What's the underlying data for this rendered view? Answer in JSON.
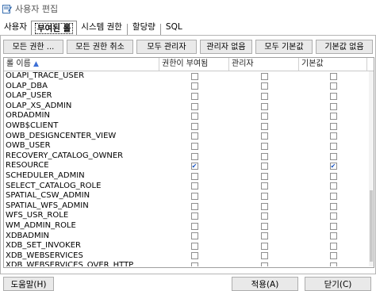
{
  "window": {
    "title": "사용자 편집",
    "icon": "edit-user-icon"
  },
  "tabs": [
    {
      "label": "사용자"
    },
    {
      "label": "부여된 롤"
    },
    {
      "label": "시스템 권한"
    },
    {
      "label": "할당량"
    },
    {
      "label": "SQL"
    }
  ],
  "toolbar": {
    "grant_all": "모든 권한 ...",
    "revoke_all": "모든 권한 취소",
    "all_admin": "모두 관리자",
    "no_admin": "관리자 없음",
    "all_default": "모두 기본값",
    "no_default": "기본값 없음"
  },
  "grid": {
    "headers": {
      "name": "롤 이름",
      "granted": "권한이 부여됨",
      "admin": "관리자",
      "default": "기본값"
    },
    "sort_icon": "sort-ascending-icon",
    "rows": [
      {
        "name": "OLAPI_TRACE_USER",
        "granted": false,
        "admin": false,
        "default": false
      },
      {
        "name": "OLAP_DBA",
        "granted": false,
        "admin": false,
        "default": false
      },
      {
        "name": "OLAP_USER",
        "granted": false,
        "admin": false,
        "default": false
      },
      {
        "name": "OLAP_XS_ADMIN",
        "granted": false,
        "admin": false,
        "default": false
      },
      {
        "name": "ORDADMIN",
        "granted": false,
        "admin": false,
        "default": false
      },
      {
        "name": "OWB$CLIENT",
        "granted": false,
        "admin": false,
        "default": false
      },
      {
        "name": "OWB_DESIGNCENTER_VIEW",
        "granted": false,
        "admin": false,
        "default": false
      },
      {
        "name": "OWB_USER",
        "granted": false,
        "admin": false,
        "default": false
      },
      {
        "name": "RECOVERY_CATALOG_OWNER",
        "granted": false,
        "admin": false,
        "default": false
      },
      {
        "name": "RESOURCE",
        "granted": true,
        "admin": false,
        "default": true
      },
      {
        "name": "SCHEDULER_ADMIN",
        "granted": false,
        "admin": false,
        "default": false
      },
      {
        "name": "SELECT_CATALOG_ROLE",
        "granted": false,
        "admin": false,
        "default": false
      },
      {
        "name": "SPATIAL_CSW_ADMIN",
        "granted": false,
        "admin": false,
        "default": false
      },
      {
        "name": "SPATIAL_WFS_ADMIN",
        "granted": false,
        "admin": false,
        "default": false
      },
      {
        "name": "WFS_USR_ROLE",
        "granted": false,
        "admin": false,
        "default": false
      },
      {
        "name": "WM_ADMIN_ROLE",
        "granted": false,
        "admin": false,
        "default": false
      },
      {
        "name": "XDBADMIN",
        "granted": false,
        "admin": false,
        "default": false
      },
      {
        "name": "XDB_SET_INVOKER",
        "granted": false,
        "admin": false,
        "default": false
      },
      {
        "name": "XDB_WEBSERVICES",
        "granted": false,
        "admin": false,
        "default": false
      },
      {
        "name": "XDB_WEBSERVICES_OVER_HTTP",
        "granted": false,
        "admin": false,
        "default": false
      }
    ]
  },
  "footer": {
    "help": "도움말(H)",
    "apply": "적용(A)",
    "close": "닫기(C)"
  },
  "colors": {
    "accent": "#1a56c4",
    "button_bg": "#e9e9e9",
    "border": "#adadad"
  }
}
